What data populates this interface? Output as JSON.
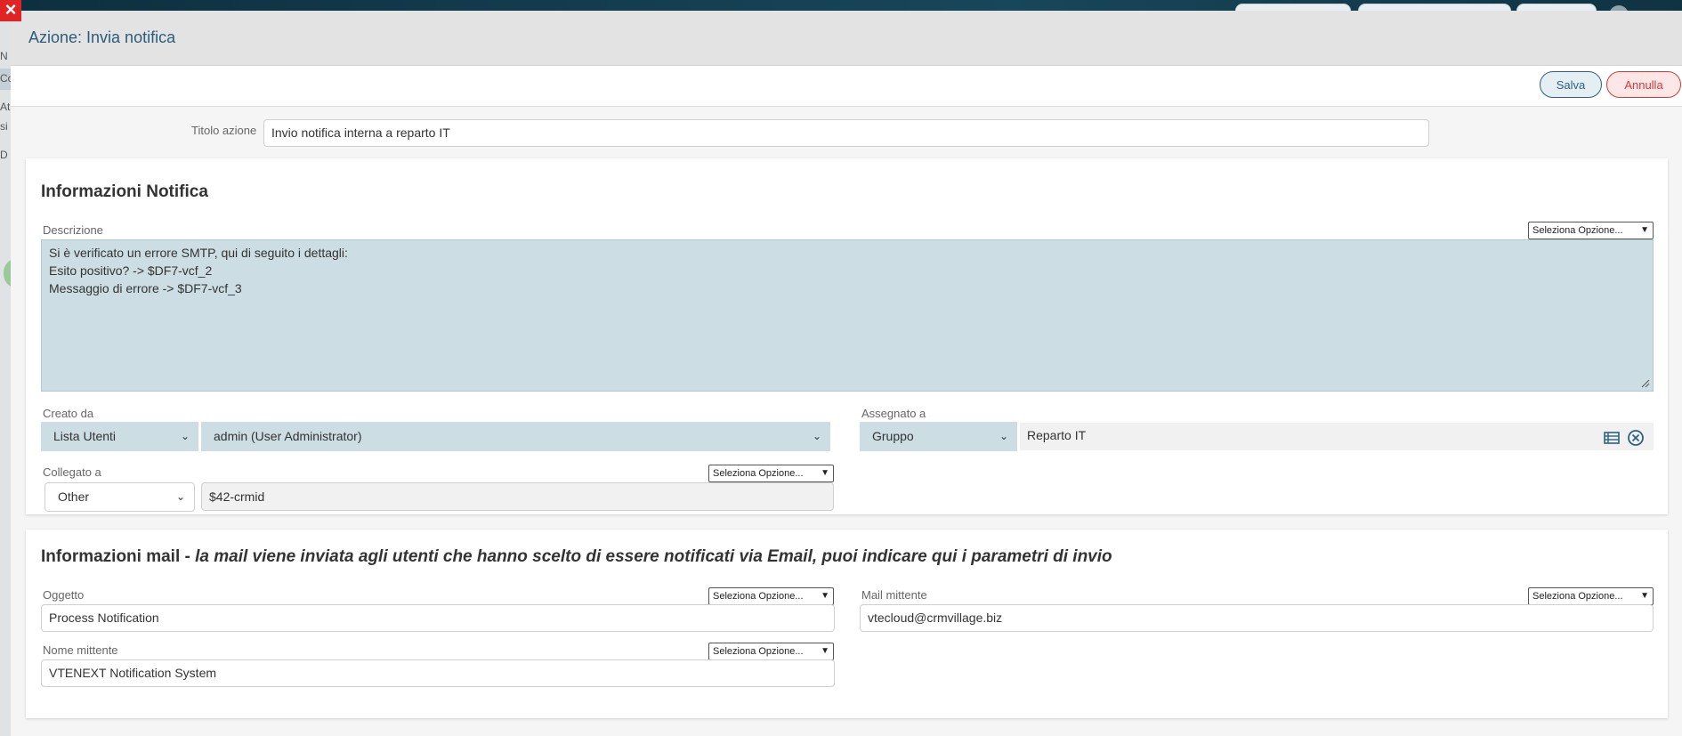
{
  "window": {
    "title": "Azione: Invia notifica"
  },
  "background": {
    "left_labels": [
      "N",
      "Co",
      "At",
      "si",
      "D"
    ]
  },
  "toolbar": {
    "save_label": "Salva",
    "cancel_label": "Annulla"
  },
  "action_title": {
    "label": "Titolo azione",
    "value": "Invio notifica interna a reparto IT"
  },
  "notification": {
    "title": "Informazioni Notifica",
    "description": {
      "label": "Descrizione",
      "option_select": "Seleziona Opzione...",
      "lines": [
        "Si è verificato un errore SMTP, qui di seguito i dettagli:",
        "Esito positivo? -> $DF7-vcf_2",
        "Messaggio di errore -> $DF7-vcf_3"
      ]
    },
    "created_by": {
      "label": "Creato da",
      "type": "Lista Utenti",
      "value": "admin (User Administrator)"
    },
    "assigned_to": {
      "label": "Assegnato a",
      "type": "Gruppo",
      "value": "Reparto IT"
    },
    "linked_to": {
      "label": "Collegato a",
      "option_select": "Seleziona Opzione...",
      "type": "Other",
      "value": "$42-crmid"
    }
  },
  "mail": {
    "title": "Informazioni mail - ",
    "title_note": "la mail viene inviata agli utenti che hanno scelto di essere notificati via Email, puoi indicare qui i parametri di invio",
    "subject": {
      "label": "Oggetto",
      "option_select": "Seleziona Opzione...",
      "value": "Process Notification"
    },
    "sender_mail": {
      "label": "Mail mittente",
      "option_select": "Seleziona Opzione...",
      "value": "vtecloud@crmvillage.biz"
    },
    "sender_name": {
      "label": "Nome mittente",
      "option_select": "Seleziona Opzione...",
      "value": "VTENEXT Notification System"
    }
  },
  "colors": {
    "accent": "#2e6180",
    "danger": "#d23b3b",
    "field_fill": "#ccdde3",
    "close": "#e02424"
  },
  "icons": [
    "close-icon",
    "list-icon",
    "clear-icon",
    "chevron-down-icon",
    "resize-handle-icon"
  ]
}
